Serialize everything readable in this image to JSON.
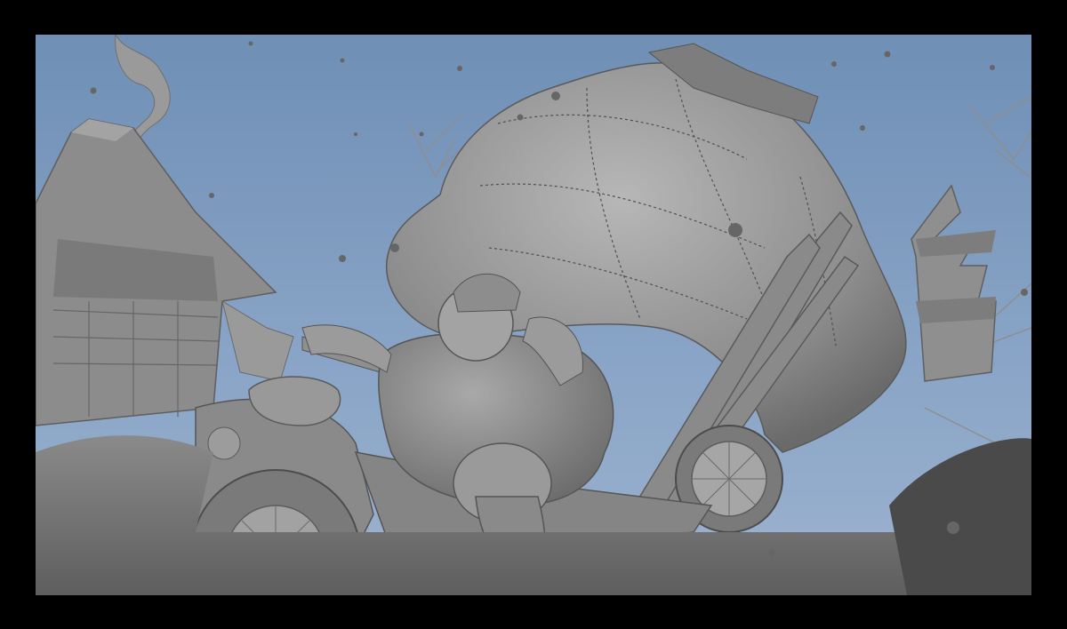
{
  "viewport": {
    "background_top_color": "#6f8fb5",
    "background_bottom_color": "#9db3cf",
    "frame_color": "#000000",
    "render_mode": "clay-shaded-3d-scene",
    "elements": {
      "chimney_smoke": "smoke-plume-icon",
      "house": "wooden-house-icon",
      "tower": "pagoda-tower-icon",
      "sack": "stitched-gift-sack-icon",
      "rider": "santa-rider-icon",
      "motorcycle": "chopper-motorcycle-icon",
      "snow": "falling-snow-icon",
      "bare_trees": "bare-tree-branches-icon"
    }
  }
}
